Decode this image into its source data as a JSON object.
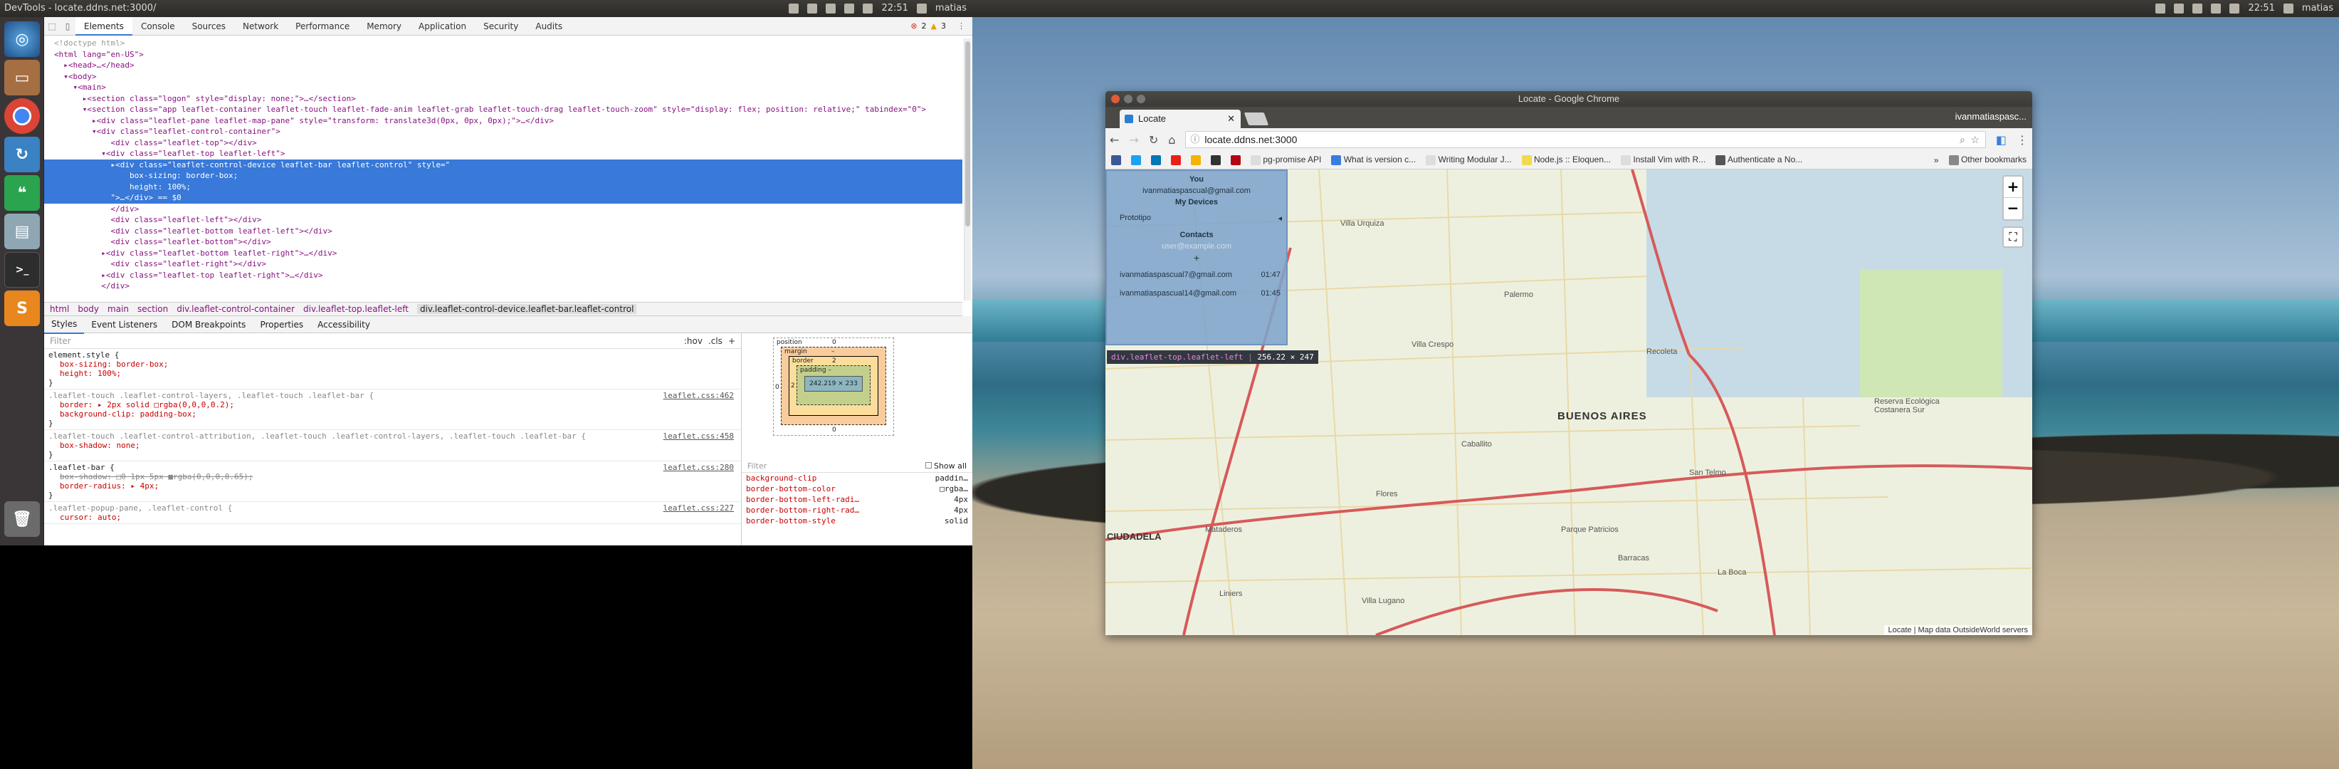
{
  "left_topbar": {
    "title": "DevTools - locate.ddns.net:3000/",
    "time": "22:51",
    "user": "matias"
  },
  "right_topbar": {
    "time": "22:51",
    "user": "matias"
  },
  "devtools": {
    "tabs": [
      "Elements",
      "Console",
      "Sources",
      "Network",
      "Performance",
      "Memory",
      "Application",
      "Security",
      "Audits"
    ],
    "active_tab": "Elements",
    "errors": "2",
    "warnings": "3",
    "dom_lines": [
      "<!doctype html>",
      "<html lang=\"en-US\">",
      "  ▸<head>…</head>",
      "  ▾<body>",
      "    ▾<main>",
      "      ▸<section class=\"logon\" style=\"display: none;\">…</section>",
      "      ▾<section class=\"app leaflet-container leaflet-touch leaflet-fade-anim leaflet-grab leaflet-touch-drag leaflet-touch-zoom\" style=\"display: flex; position: relative;\" tabindex=\"0\">",
      "        ▸<div class=\"leaflet-pane leaflet-map-pane\" style=\"transform: translate3d(0px, 0px, 0px);\">…</div>",
      "        ▾<div class=\"leaflet-control-container\">",
      "            <div class=\"leaflet-top\"></div>",
      "          ▾<div class=\"leaflet-top leaflet-left\">",
      "            ▸<div class=\"leaflet-control-device leaflet-bar leaflet-control\" style=\"",
      "                box-sizing: border-box;",
      "                height: 100%;",
      "            \">…</div> == $0",
      "            </div>",
      "            <div class=\"leaflet-left\"></div>",
      "            <div class=\"leaflet-bottom leaflet-left\"></div>",
      "            <div class=\"leaflet-bottom\"></div>",
      "          ▸<div class=\"leaflet-bottom leaflet-right\">…</div>",
      "            <div class=\"leaflet-right\"></div>",
      "          ▸<div class=\"leaflet-top leaflet-right\">…</div>",
      "          </div>"
    ],
    "breadcrumbs": [
      "html",
      "body",
      "main",
      "section",
      "div.leaflet-control-container",
      "div.leaflet-top.leaflet-left",
      "div.leaflet-control-device.leaflet-bar.leaflet-control"
    ],
    "subtabs": [
      "Styles",
      "Event Listeners",
      "DOM Breakpoints",
      "Properties",
      "Accessibility"
    ],
    "active_subtab": "Styles",
    "filter_placeholder": "Filter",
    "hov": ":hov",
    ".cls": ".cls",
    "rules": [
      {
        "selector": "element.style {",
        "props": [
          "box-sizing: border-box;",
          "height: 100%;"
        ],
        "src": "",
        "close": "}"
      },
      {
        "selector": ".leaflet-touch .leaflet-control-layers, .leaflet-touch .leaflet-bar {",
        "props": [
          "border: ▸ 2px solid □rgba(0,0,0,0.2);",
          "background-clip: padding-box;"
        ],
        "src": "leaflet.css:462",
        "close": "}"
      },
      {
        "selector": ".leaflet-touch .leaflet-control-attribution, .leaflet-touch .leaflet-control-layers, .leaflet-touch .leaflet-bar {",
        "props": [
          "box-shadow: none;"
        ],
        "src": "leaflet.css:458",
        "close": "}"
      },
      {
        "selector": ".leaflet-bar {",
        "props": [
          "box-shadow: □0 1px 5px ■rgba(0,0,0,0.65);",
          "border-radius: ▸ 4px;"
        ],
        "src": "leaflet.css:280",
        "close": "}"
      },
      {
        "selector": ".leaflet-popup-pane, .leaflet-control {",
        "props": [
          "cursor: auto;"
        ],
        "src": "leaflet.css:227",
        "close": ""
      }
    ],
    "boxmodel": {
      "position": "position",
      "position_val": "0",
      "margin": "margin",
      "margin_val": "–",
      "border": "border",
      "border_val": "2",
      "padding": "padding –",
      "content": "242.219 × 233",
      "left_val": "0",
      "side": "2",
      "bottom_val": "0"
    },
    "computed_filter": "Filter",
    "show_all": "Show all",
    "computed": [
      {
        "name": "background-clip",
        "value": "paddin…"
      },
      {
        "name": "border-bottom-color",
        "value": "□rgba…"
      },
      {
        "name": "border-bottom-left-radi…",
        "value": "4px"
      },
      {
        "name": "border-bottom-right-rad…",
        "value": "4px"
      },
      {
        "name": "border-bottom-style",
        "value": "solid"
      }
    ]
  },
  "chrome": {
    "window_title": "Locate - Google Chrome",
    "tab_title": "Locate",
    "user": "ivanmatiaspasc...",
    "url": "locate.ddns.net:3000",
    "bookmarks": [
      "pg-promise API",
      "What is version c...",
      "Writing Modular J...",
      "Node.js :: Eloquen...",
      "Install Vim with R...",
      "Authenticate a No..."
    ],
    "bookmarks_more": "»",
    "other_bookmarks": "Other bookmarks",
    "panel": {
      "you": "You",
      "you_email": "ivanmatiaspascual@gmail.com",
      "my_devices": "My Devices",
      "prototipo": "Prototipo",
      "contacts": "Contacts",
      "contact_placeholder": "user@example.com",
      "add": "+",
      "contacts_list": [
        {
          "email": "ivanmatiaspascual7@gmail.com",
          "time": "01:47"
        },
        {
          "email": "ivanmatiaspascual14@gmail.com",
          "time": "01:45"
        }
      ]
    },
    "tooltip": {
      "selector": "div.leaflet-top.leaflet-left",
      "size": "256.22 × 247"
    },
    "zoom_in": "+",
    "zoom_out": "−",
    "fullscreen": "⛶",
    "attribution": "Locate | Map data OutsideWorld servers",
    "map_labels": [
      "BUENOS AIRES",
      "CIUDADELA",
      "Reserva Ecológica Costanera Sur",
      "Villa Urquiza",
      "Villa Crespo",
      "Palermo",
      "Recoleta",
      "San Telmo",
      "La Boca",
      "Barracas",
      "Flores",
      "Caballito",
      "Mataderos",
      "Liniers",
      "Villa Lugano",
      "Parque Patricios"
    ]
  }
}
